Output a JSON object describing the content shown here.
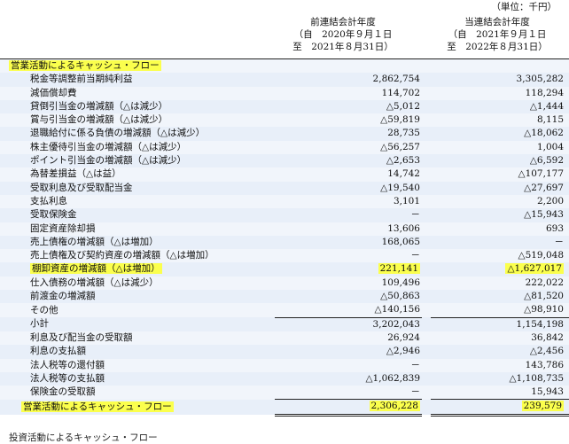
{
  "unit_note": "（単位：千円）",
  "headers": {
    "prev": {
      "title": "前連結会計年度",
      "from": "（自　2020年９月１日",
      "to": "至　2021年８月31日）"
    },
    "curr": {
      "title": "当連結会計年度",
      "from": "（自　2021年９月１日",
      "to": "至　2022年８月31日）"
    }
  },
  "rows": [
    {
      "label": "営業活動によるキャッシュ・フロー",
      "prev": "",
      "curr": "",
      "section": true,
      "hl_label": true
    },
    {
      "label": "税金等調整前当期純利益",
      "prev": "2,862,754",
      "curr": "3,305,282"
    },
    {
      "label": "減価償却費",
      "prev": "114,702",
      "curr": "118,294"
    },
    {
      "label": "貸倒引当金の増減額（△は減少）",
      "prev": "△5,012",
      "curr": "△1,444"
    },
    {
      "label": "賞与引当金の増減額（△は減少）",
      "prev": "△59,819",
      "curr": "8,115"
    },
    {
      "label": "退職給付に係る負債の増減額（△は減少）",
      "prev": "28,735",
      "curr": "△18,062"
    },
    {
      "label": "株主優待引当金の増減額（△は減少）",
      "prev": "△56,257",
      "curr": "1,004"
    },
    {
      "label": "ポイント引当金の増減額（△は減少）",
      "prev": "△2,653",
      "curr": "△6,592"
    },
    {
      "label": "為替差損益（△は益）",
      "prev": "14,742",
      "curr": "△107,177"
    },
    {
      "label": "受取利息及び受取配当金",
      "prev": "△19,540",
      "curr": "△27,697"
    },
    {
      "label": "支払利息",
      "prev": "3,101",
      "curr": "2,200"
    },
    {
      "label": "受取保険金",
      "prev": "－",
      "curr": "△15,943"
    },
    {
      "label": "固定資産除却損",
      "prev": "13,606",
      "curr": "693"
    },
    {
      "label": "売上債権の増減額（△は増加）",
      "prev": "168,065",
      "curr": "－"
    },
    {
      "label": "売上債権及び契約資産の増減額（△は増加）",
      "prev": "－",
      "curr": "△519,048"
    },
    {
      "label": "棚卸資産の増減額（△は増加）",
      "prev": "221,141",
      "curr": "△1,627,017",
      "hl_label": true,
      "hl_values": true
    },
    {
      "label": "仕入債務の増減額（△は減少）",
      "prev": "109,496",
      "curr": "222,022"
    },
    {
      "label": "前渡金の増減額",
      "prev": "△50,863",
      "curr": "△81,520"
    },
    {
      "label": "その他",
      "prev": "△140,156",
      "curr": "△98,910"
    },
    {
      "label": "小計",
      "prev": "3,202,043",
      "curr": "1,154,198",
      "subtotal": true
    },
    {
      "label": "利息及び配当金の受取額",
      "prev": "26,924",
      "curr": "36,842"
    },
    {
      "label": "利息の支払額",
      "prev": "△2,946",
      "curr": "△2,456"
    },
    {
      "label": "法人税等の還付額",
      "prev": "－",
      "curr": "143,786"
    },
    {
      "label": "法人税等の支払額",
      "prev": "△1,062,839",
      "curr": "△1,108,735"
    },
    {
      "label": "保険金の受取額",
      "prev": "－",
      "curr": "15,943"
    },
    {
      "label": "営業活動によるキャッシュ・フロー",
      "prev": "2,306,228",
      "curr": "239,579",
      "total": true,
      "hl_label": true,
      "hl_values": true
    }
  ],
  "cut_off_text": "投資活動によるキャッシュ・フロー"
}
